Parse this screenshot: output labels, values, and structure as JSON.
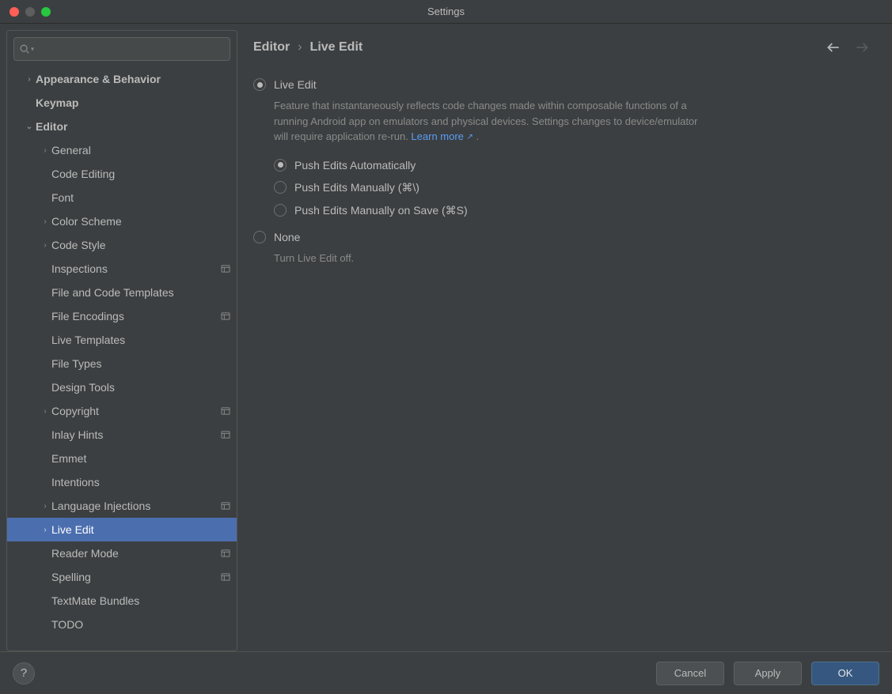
{
  "window": {
    "title": "Settings"
  },
  "search": {
    "placeholder": ""
  },
  "tree": [
    {
      "id": "appearance",
      "label": "Appearance & Behavior",
      "indent": 0,
      "bold": true,
      "expandable": true,
      "expanded": false,
      "marker": false
    },
    {
      "id": "keymap",
      "label": "Keymap",
      "indent": 0,
      "bold": true,
      "expandable": false,
      "expanded": false,
      "marker": false
    },
    {
      "id": "editor",
      "label": "Editor",
      "indent": 0,
      "bold": true,
      "expandable": true,
      "expanded": true,
      "marker": false
    },
    {
      "id": "general",
      "label": "General",
      "indent": 1,
      "bold": false,
      "expandable": true,
      "expanded": false,
      "marker": false
    },
    {
      "id": "code-editing",
      "label": "Code Editing",
      "indent": 1,
      "bold": false,
      "expandable": false,
      "expanded": false,
      "marker": false
    },
    {
      "id": "font",
      "label": "Font",
      "indent": 1,
      "bold": false,
      "expandable": false,
      "expanded": false,
      "marker": false
    },
    {
      "id": "color-scheme",
      "label": "Color Scheme",
      "indent": 1,
      "bold": false,
      "expandable": true,
      "expanded": false,
      "marker": false
    },
    {
      "id": "code-style",
      "label": "Code Style",
      "indent": 1,
      "bold": false,
      "expandable": true,
      "expanded": false,
      "marker": false
    },
    {
      "id": "inspections",
      "label": "Inspections",
      "indent": 1,
      "bold": false,
      "expandable": false,
      "expanded": false,
      "marker": true
    },
    {
      "id": "file-templates",
      "label": "File and Code Templates",
      "indent": 1,
      "bold": false,
      "expandable": false,
      "expanded": false,
      "marker": false
    },
    {
      "id": "file-encodings",
      "label": "File Encodings",
      "indent": 1,
      "bold": false,
      "expandable": false,
      "expanded": false,
      "marker": true
    },
    {
      "id": "live-templates",
      "label": "Live Templates",
      "indent": 1,
      "bold": false,
      "expandable": false,
      "expanded": false,
      "marker": false
    },
    {
      "id": "file-types",
      "label": "File Types",
      "indent": 1,
      "bold": false,
      "expandable": false,
      "expanded": false,
      "marker": false
    },
    {
      "id": "design-tools",
      "label": "Design Tools",
      "indent": 1,
      "bold": false,
      "expandable": false,
      "expanded": false,
      "marker": false
    },
    {
      "id": "copyright",
      "label": "Copyright",
      "indent": 1,
      "bold": false,
      "expandable": true,
      "expanded": false,
      "marker": true
    },
    {
      "id": "inlay-hints",
      "label": "Inlay Hints",
      "indent": 1,
      "bold": false,
      "expandable": false,
      "expanded": false,
      "marker": true
    },
    {
      "id": "emmet",
      "label": "Emmet",
      "indent": 1,
      "bold": false,
      "expandable": false,
      "expanded": false,
      "marker": false
    },
    {
      "id": "intentions",
      "label": "Intentions",
      "indent": 1,
      "bold": false,
      "expandable": false,
      "expanded": false,
      "marker": false
    },
    {
      "id": "lang-injections",
      "label": "Language Injections",
      "indent": 1,
      "bold": false,
      "expandable": true,
      "expanded": false,
      "marker": true
    },
    {
      "id": "live-edit",
      "label": "Live Edit",
      "indent": 1,
      "bold": false,
      "expandable": true,
      "expanded": false,
      "marker": false,
      "selected": true
    },
    {
      "id": "reader-mode",
      "label": "Reader Mode",
      "indent": 1,
      "bold": false,
      "expandable": false,
      "expanded": false,
      "marker": true
    },
    {
      "id": "spelling",
      "label": "Spelling",
      "indent": 1,
      "bold": false,
      "expandable": false,
      "expanded": false,
      "marker": true
    },
    {
      "id": "textmate",
      "label": "TextMate Bundles",
      "indent": 1,
      "bold": false,
      "expandable": false,
      "expanded": false,
      "marker": false
    },
    {
      "id": "todo",
      "label": "TODO",
      "indent": 1,
      "bold": false,
      "expandable": false,
      "expanded": false,
      "marker": false
    }
  ],
  "breadcrumb": {
    "parent": "Editor",
    "current": "Live Edit"
  },
  "content": {
    "mode_group_selected": "live-edit",
    "live_edit": {
      "label": "Live Edit",
      "description_pre": "Feature that instantaneously reflects code changes made within composable functions of a running Android app on emulators and physical devices. Settings changes to device/emulator will require application re-run. ",
      "learn_more": "Learn more",
      "description_post": " .",
      "sub_selected": "auto",
      "sub_options": {
        "auto": "Push Edits Automatically",
        "manual": "Push Edits Manually (⌘\\)",
        "on_save": "Push Edits Manually on Save (⌘S)"
      }
    },
    "none": {
      "label": "None",
      "description": "Turn Live Edit off."
    }
  },
  "footer": {
    "help": "?",
    "cancel": "Cancel",
    "apply": "Apply",
    "ok": "OK"
  }
}
